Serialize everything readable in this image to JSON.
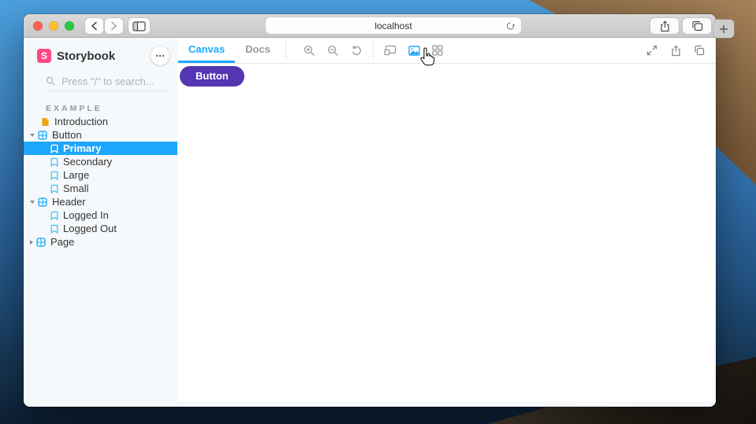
{
  "colors": {
    "accent": "#1ea7fd",
    "brand": "#ff4785",
    "button_primary": "#5435b2",
    "selected_row_bg": "#1ea7fd",
    "sidebar_bg": "#f6f9fc",
    "traffic_red": "#ff5f57",
    "traffic_yellow": "#febc2e",
    "traffic_green": "#28c840"
  },
  "browser": {
    "url": "localhost",
    "new_tab_label": "+",
    "controls": [
      "back",
      "forward",
      "sidebar-toggle",
      "reload",
      "share",
      "tab-overview",
      "new-tab"
    ],
    "traffic_lights": [
      "close",
      "minimize",
      "zoom"
    ]
  },
  "sidebar": {
    "title": "Storybook",
    "logo_letter": "S",
    "menu_icon": "ellipsis-menu",
    "search_placeholder": "Press \"/\" to search...",
    "section_label": "EXAMPLE",
    "items": [
      {
        "label": "Introduction",
        "type": "document"
      },
      {
        "label": "Button",
        "type": "component",
        "state": "expanded"
      },
      {
        "label": "Primary",
        "type": "story",
        "selected": true
      },
      {
        "label": "Secondary",
        "type": "story"
      },
      {
        "label": "Large",
        "type": "story"
      },
      {
        "label": "Small",
        "type": "story"
      },
      {
        "label": "Header",
        "type": "component",
        "state": "expanded"
      },
      {
        "label": "Logged In",
        "type": "story"
      },
      {
        "label": "Logged Out",
        "type": "story"
      },
      {
        "label": "Page",
        "type": "component",
        "state": "collapsed"
      }
    ]
  },
  "toolbar": {
    "tabs": [
      {
        "label": "Canvas",
        "active": true
      },
      {
        "label": "Docs",
        "active": false
      }
    ],
    "icons": [
      "zoom-in",
      "zoom-out",
      "zoom-reset",
      "viewport",
      "background",
      "grid"
    ],
    "hovered_icon": "background",
    "right_icons": [
      "fullscreen",
      "share",
      "copy-link"
    ]
  },
  "canvas": {
    "button_label": "Button"
  }
}
